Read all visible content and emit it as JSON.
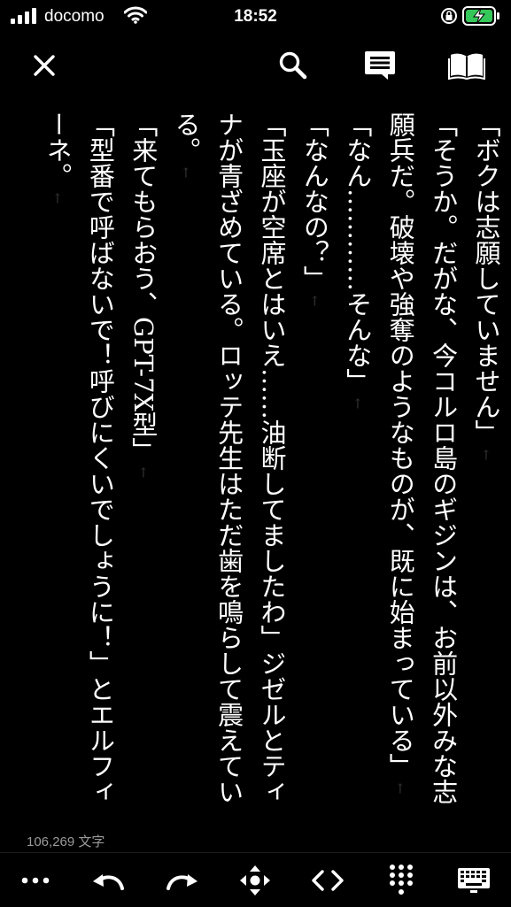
{
  "status_bar": {
    "carrier": "docomo",
    "time": "18:52"
  },
  "toolbar": {
    "icons": [
      "close-icon",
      "search-icon",
      "comment-icon",
      "book-icon"
    ]
  },
  "content": {
    "paragraphs": [
      "「ボクは志願していません」",
      "「そうか。だがな、今コルロ島のギジンは、お前以外みな志願兵だ。破壊や強奪のようなものが、既に始まっている」",
      "「なん…………そんな」",
      "「なんなの？」",
      "「玉座が空席とはいえ……油断してましたわ」ジゼルとティナが青ざめている。ロッテ先生はただ歯を鳴らして震えている。",
      "「来てもらおう、GPT-7X型」",
      "「型番で呼ばないで！呼びにくいでしょうに！」とエルフィーネ。"
    ]
  },
  "footer": {
    "char_count": "106,269 文字"
  },
  "bottom_bar": {
    "icons": [
      "more-icon",
      "undo-icon",
      "redo-icon",
      "move-cursor-icon",
      "code-brackets-icon",
      "keypad-icon",
      "keyboard-icon"
    ]
  }
}
